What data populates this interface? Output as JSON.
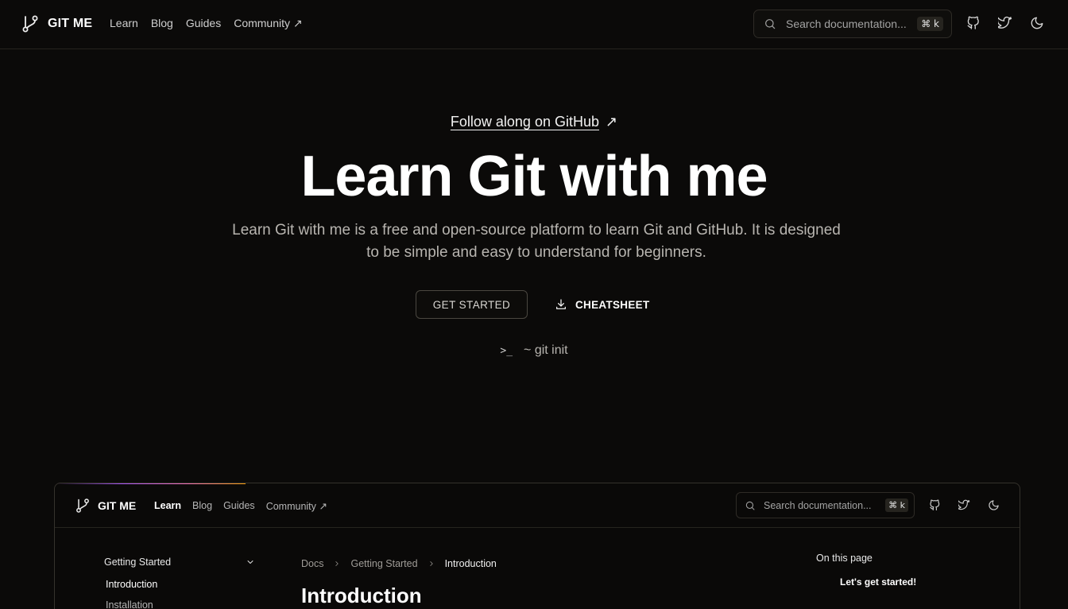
{
  "app": {
    "brand": "GIT ME",
    "nav": [
      "Learn",
      "Blog",
      "Guides",
      "Community ↗"
    ],
    "search_placeholder": "Search documentation...",
    "shortcut": "⌘ k"
  },
  "hero": {
    "follow_text": "Follow along on GitHub",
    "follow_arrow": "↗",
    "headline": "Learn Git with me",
    "subtext": "Learn Git with me is a free and open-source platform to learn Git and GitHub. It is designed to be simple and easy to understand for beginners.",
    "get_started": "GET STARTED",
    "cheatsheet": "CHEATSHEET",
    "terminal_prompt": ">_",
    "terminal_command": "~ git init"
  },
  "preview": {
    "brand": "GIT ME",
    "nav": [
      "Learn",
      "Blog",
      "Guides",
      "Community ↗"
    ],
    "search_placeholder": "Search documentation...",
    "shortcut": "⌘ k",
    "sidebar": {
      "group": "Getting Started",
      "items": [
        "Introduction",
        "Installation"
      ]
    },
    "breadcrumb": [
      "Docs",
      "Getting Started",
      "Introduction"
    ],
    "page_title": "Introduction",
    "toc_title": "On this page",
    "toc_items": [
      "Let's get started!"
    ]
  },
  "colors": {
    "background": "#0b0a09",
    "text": "#ffffff",
    "muted": "#b8b5b0",
    "accent_gradient": [
      "#a855f7",
      "#f472b6",
      "#f59e0b"
    ]
  }
}
